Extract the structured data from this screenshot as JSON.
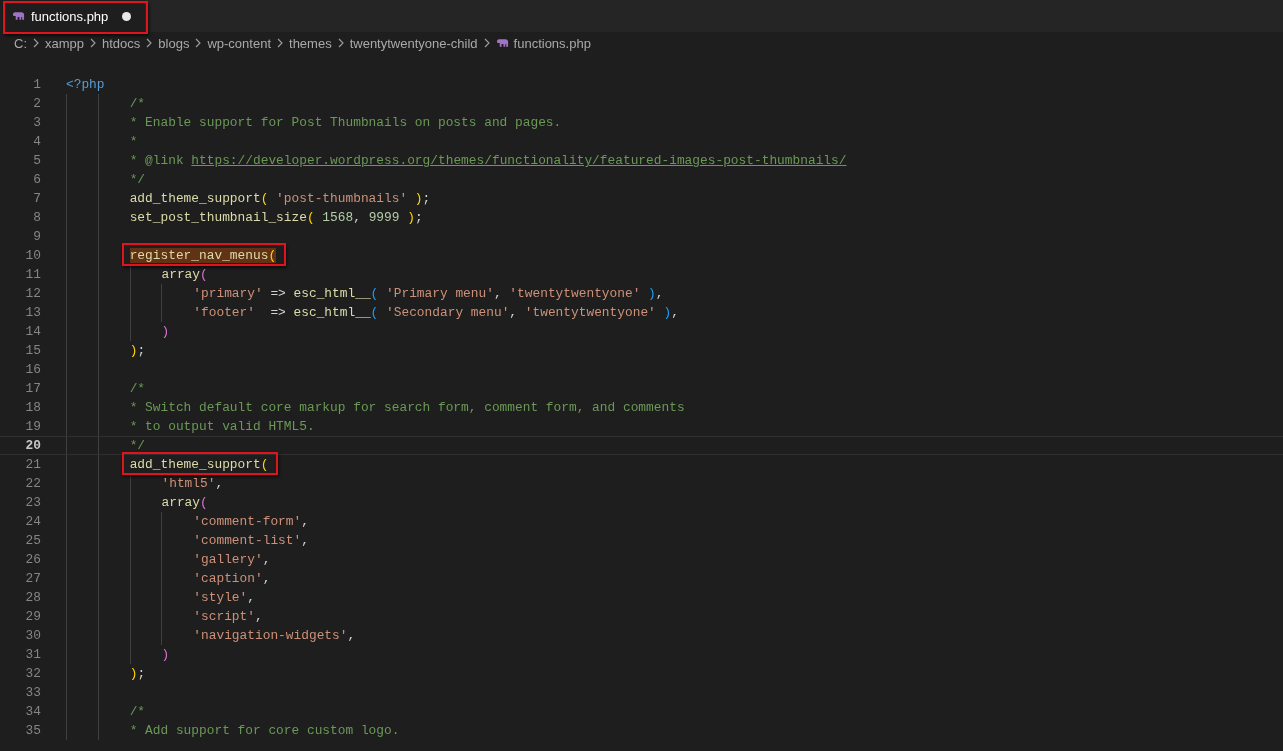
{
  "tabs": [
    {
      "label": "functions.php",
      "kind": "php",
      "selected": true,
      "modified": true,
      "annotated": true
    }
  ],
  "breadcrumb": [
    {
      "label": "C:",
      "kind": "folder"
    },
    {
      "label": "xampp",
      "kind": "folder"
    },
    {
      "label": "htdocs",
      "kind": "folder"
    },
    {
      "label": "blogs",
      "kind": "folder"
    },
    {
      "label": "wp-content",
      "kind": "folder"
    },
    {
      "label": "themes",
      "kind": "folder"
    },
    {
      "label": "twentytwentyone-child",
      "kind": "folder"
    },
    {
      "label": "functions.php",
      "kind": "php"
    }
  ],
  "editor": {
    "lines": [
      {
        "number": "1",
        "tokens": [
          {
            "text": "<?php",
            "kind": "keyword"
          }
        ],
        "children": [
          {
            "number": "2",
            "tokens": [
              {
                "text": "/*",
                "kind": "comment"
              }
            ]
          },
          {
            "number": "3",
            "tokens": [
              {
                "text": "* Enable support for Post Thumbnails on posts and pages.",
                "kind": "comment"
              }
            ]
          },
          {
            "number": "4",
            "tokens": [
              {
                "text": "*",
                "kind": "comment"
              }
            ]
          },
          {
            "number": "5",
            "tokens": [
              {
                "text": "* @link ",
                "kind": "comment"
              },
              {
                "text": "https://developer.wordpress.org/themes/functionality/featured-images-post-thumbnails/",
                "kind": "link"
              }
            ]
          },
          {
            "number": "6",
            "tokens": [
              {
                "text": "*/",
                "kind": "comment"
              }
            ]
          },
          {
            "number": "7",
            "tokens": [
              {
                "text": "add_theme_support",
                "kind": "function"
              },
              {
                "text": "( ",
                "kind": "paren1"
              },
              {
                "text": "'post-thumbnails'",
                "kind": "string"
              },
              {
                "text": " )",
                "kind": "paren1"
              },
              {
                "text": ";",
                "kind": "plain"
              }
            ]
          },
          {
            "number": "8",
            "tokens": [
              {
                "text": "set_post_thumbnail_size",
                "kind": "function"
              },
              {
                "text": "( ",
                "kind": "paren1"
              },
              {
                "text": "1568",
                "kind": "number"
              },
              {
                "text": ", ",
                "kind": "plain"
              },
              {
                "text": "9999",
                "kind": "number"
              },
              {
                "text": " )",
                "kind": "paren1"
              },
              {
                "text": ";",
                "kind": "plain"
              }
            ]
          },
          {
            "number": "9"
          },
          {
            "number": "10",
            "annotated": true,
            "tokens": [
              {
                "text": "register_nav_menus",
                "kind": "function",
                "highlighted": true
              },
              {
                "text": "(",
                "kind": "paren1",
                "highlighted": true
              }
            ],
            "children": [
              {
                "number": "11",
                "tokens": [
                  {
                    "text": "array",
                    "kind": "function"
                  },
                  {
                    "text": "(",
                    "kind": "paren2"
                  }
                ],
                "children": [
                  {
                    "number": "12",
                    "tokens": [
                      {
                        "text": "'primary'",
                        "kind": "string"
                      },
                      {
                        "text": " => ",
                        "kind": "plain"
                      },
                      {
                        "text": "esc_html__",
                        "kind": "function"
                      },
                      {
                        "text": "( ",
                        "kind": "paren3"
                      },
                      {
                        "text": "'Primary menu'",
                        "kind": "string"
                      },
                      {
                        "text": ", ",
                        "kind": "plain"
                      },
                      {
                        "text": "'twentytwentyone'",
                        "kind": "string"
                      },
                      {
                        "text": " )",
                        "kind": "paren3"
                      },
                      {
                        "text": ",",
                        "kind": "plain"
                      }
                    ]
                  },
                  {
                    "number": "13",
                    "tokens": [
                      {
                        "text": "'footer'",
                        "kind": "string"
                      },
                      {
                        "text": "  => ",
                        "kind": "plain"
                      },
                      {
                        "text": "esc_html__",
                        "kind": "function"
                      },
                      {
                        "text": "( ",
                        "kind": "paren3"
                      },
                      {
                        "text": "'Secondary menu'",
                        "kind": "string"
                      },
                      {
                        "text": ", ",
                        "kind": "plain"
                      },
                      {
                        "text": "'twentytwentyone'",
                        "kind": "string"
                      },
                      {
                        "text": " )",
                        "kind": "paren3"
                      },
                      {
                        "text": ",",
                        "kind": "plain"
                      }
                    ]
                  }
                ]
              },
              {
                "number": "14",
                "tokens": [
                  {
                    "text": ")",
                    "kind": "paren2"
                  }
                ]
              }
            ]
          },
          {
            "number": "15",
            "tokens": [
              {
                "text": ")",
                "kind": "paren1"
              },
              {
                "text": ";",
                "kind": "plain"
              }
            ]
          },
          {
            "number": "16"
          },
          {
            "number": "17",
            "tokens": [
              {
                "text": "/*",
                "kind": "comment"
              }
            ]
          },
          {
            "number": "18",
            "tokens": [
              {
                "text": "* Switch default core markup for search form, comment form, and comments",
                "kind": "comment"
              }
            ]
          },
          {
            "number": "19",
            "tokens": [
              {
                "text": "* to output valid HTML5.",
                "kind": "comment"
              }
            ]
          },
          {
            "number": "20",
            "current": true,
            "tokens": [
              {
                "text": "*/",
                "kind": "comment"
              }
            ]
          },
          {
            "number": "21",
            "annotated": true,
            "tokens": [
              {
                "text": "add_theme_support",
                "kind": "function"
              },
              {
                "text": "(",
                "kind": "paren1"
              }
            ],
            "children": [
              {
                "number": "22",
                "tokens": [
                  {
                    "text": "'html5'",
                    "kind": "string"
                  },
                  {
                    "text": ",",
                    "kind": "plain"
                  }
                ]
              },
              {
                "number": "23",
                "tokens": [
                  {
                    "text": "array",
                    "kind": "function"
                  },
                  {
                    "text": "(",
                    "kind": "paren2"
                  }
                ],
                "children": [
                  {
                    "number": "24",
                    "tokens": [
                      {
                        "text": "'comment-form'",
                        "kind": "string"
                      },
                      {
                        "text": ",",
                        "kind": "plain"
                      }
                    ]
                  },
                  {
                    "number": "25",
                    "tokens": [
                      {
                        "text": "'comment-list'",
                        "kind": "string"
                      },
                      {
                        "text": ",",
                        "kind": "plain"
                      }
                    ]
                  },
                  {
                    "number": "26",
                    "tokens": [
                      {
                        "text": "'gallery'",
                        "kind": "string"
                      },
                      {
                        "text": ",",
                        "kind": "plain"
                      }
                    ]
                  },
                  {
                    "number": "27",
                    "tokens": [
                      {
                        "text": "'caption'",
                        "kind": "string"
                      },
                      {
                        "text": ",",
                        "kind": "plain"
                      }
                    ]
                  },
                  {
                    "number": "28",
                    "tokens": [
                      {
                        "text": "'style'",
                        "kind": "string"
                      },
                      {
                        "text": ",",
                        "kind": "plain"
                      }
                    ]
                  },
                  {
                    "number": "29",
                    "tokens": [
                      {
                        "text": "'script'",
                        "kind": "string"
                      },
                      {
                        "text": ",",
                        "kind": "plain"
                      }
                    ]
                  },
                  {
                    "number": "30",
                    "tokens": [
                      {
                        "text": "'navigation-widgets'",
                        "kind": "string"
                      },
                      {
                        "text": ",",
                        "kind": "plain"
                      }
                    ]
                  }
                ]
              },
              {
                "number": "31",
                "tokens": [
                  {
                    "text": ")",
                    "kind": "paren2"
                  }
                ]
              }
            ]
          },
          {
            "number": "32",
            "tokens": [
              {
                "text": ")",
                "kind": "paren1"
              },
              {
                "text": ";",
                "kind": "plain"
              }
            ]
          },
          {
            "number": "33"
          },
          {
            "number": "34",
            "tokens": [
              {
                "text": "/*",
                "kind": "comment"
              }
            ]
          },
          {
            "number": "35",
            "tokens": [
              {
                "text": "* Add support for core custom logo.",
                "kind": "comment"
              }
            ]
          }
        ]
      }
    ]
  }
}
